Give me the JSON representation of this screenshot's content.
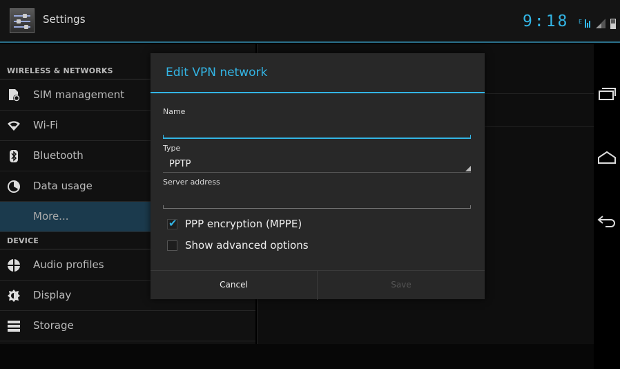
{
  "app": {
    "title": "Settings",
    "icon": "settings-sliders-icon"
  },
  "status_bar": {
    "time": "9:18",
    "icons": [
      "data-signal-icon",
      "cell-signal-icon",
      "battery-icon"
    ]
  },
  "sidebar": {
    "sections": [
      {
        "header": "WIRELESS & NETWORKS"
      },
      {
        "header": "DEVICE"
      }
    ],
    "items": [
      {
        "label": "SIM management",
        "icon": "sim-card-icon"
      },
      {
        "label": "Wi-Fi",
        "icon": "wifi-icon"
      },
      {
        "label": "Bluetooth",
        "icon": "bluetooth-icon"
      },
      {
        "label": "Data usage",
        "icon": "data-usage-icon"
      },
      {
        "label": "More...",
        "icon": "",
        "active": true
      },
      {
        "label": "Audio profiles",
        "icon": "audio-profiles-icon"
      },
      {
        "label": "Display",
        "icon": "display-icon"
      },
      {
        "label": "Storage",
        "icon": "storage-icon"
      }
    ]
  },
  "dialog": {
    "title": "Edit VPN network",
    "name_label": "Name",
    "name_value": "",
    "type_label": "Type",
    "type_value": "PPTP",
    "server_label": "Server address",
    "server_value": "",
    "ppp_encryption_label": "PPP encryption (MPPE)",
    "ppp_encryption_checked": true,
    "advanced_label": "Show advanced options",
    "advanced_checked": false,
    "cancel_label": "Cancel",
    "save_label": "Save"
  },
  "navbar": {
    "buttons": [
      "recent-apps-icon",
      "home-icon",
      "back-icon"
    ]
  },
  "colors": {
    "accent": "#33b5e5",
    "background": "#000000",
    "dialog": "#282828"
  }
}
